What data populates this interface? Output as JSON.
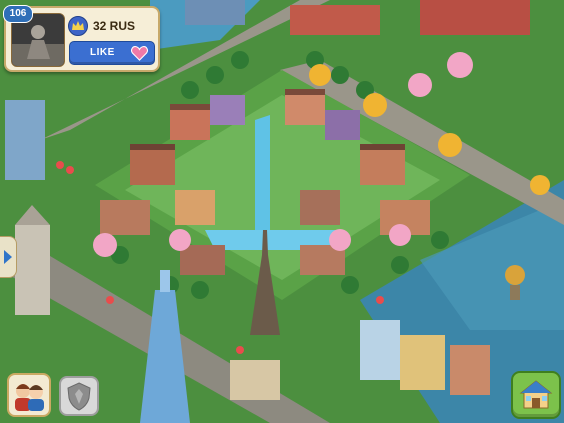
{
  "player": {
    "level": "106",
    "name": "32 RUS",
    "like_label": "LIKE"
  },
  "icons": {
    "crown": "crown-icon",
    "heart": "heart-icon",
    "side_arrow": "chevron-right-icon",
    "friends": "friends-icon",
    "disabled": "shield-icon",
    "home": "home-icon"
  },
  "colors": {
    "like_button": "#3b6fd1",
    "heart": "#f07aa8",
    "home_button": "#7cc24b",
    "panel": "#f6eed7"
  }
}
